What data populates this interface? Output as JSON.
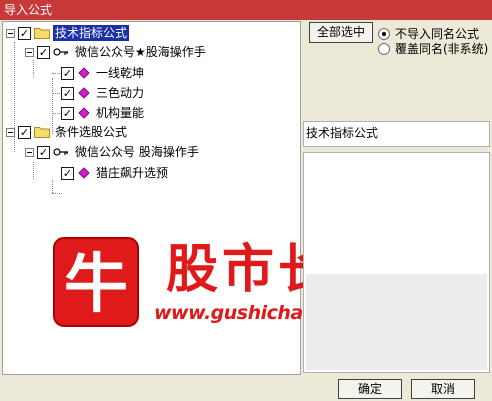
{
  "window": {
    "title": "导入公式"
  },
  "tree": {
    "root1": {
      "label": "技术指标公式",
      "checked": true,
      "expanded": true
    },
    "root1_child": {
      "label": "微信公众号★股海操作手",
      "checked": true
    },
    "root1_items": [
      {
        "label": "一线乾坤",
        "checked": true
      },
      {
        "label": "三色动力",
        "checked": true
      },
      {
        "label": "机构量能",
        "checked": true
      }
    ],
    "root2": {
      "label": "条件选股公式",
      "checked": true,
      "expanded": true
    },
    "root2_child": {
      "label": "微信公众号 股海操作手",
      "checked": true
    },
    "root2_items": [
      {
        "label": "猎庄飙升选预",
        "checked": true
      }
    ],
    "check_mark": "✓"
  },
  "watermark": {
    "logo_char": "牛",
    "brand": "股市长红",
    "url": "www.gushichanghong.com"
  },
  "options": {
    "select_all_label": "全部选中",
    "radio_skip": "不导入同名公式",
    "radio_overwrite": "覆盖同名(非系统)",
    "selected": "radio_skip"
  },
  "info": {
    "category_label": "技术指标公式"
  },
  "footer": {
    "ok_label": "确定",
    "cancel_label": "取消"
  },
  "colors": {
    "title_bar": "#c8393a",
    "selection": "#1a2fa8",
    "brand_red": "#e01a1a",
    "item_icon": "#d020c8"
  }
}
